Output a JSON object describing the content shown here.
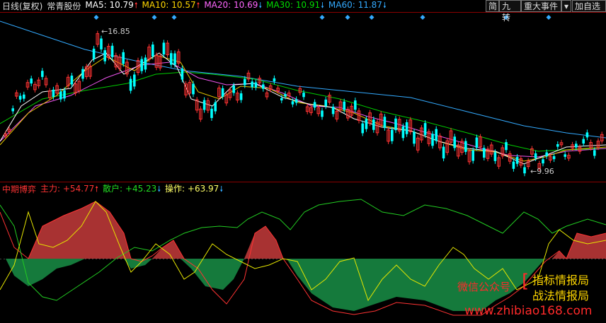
{
  "header": {
    "period": "日线(复权)",
    "stock": "常青股份",
    "ma": [
      {
        "label": "MA5: 10.79",
        "color": "#ffffff",
        "dir": "up"
      },
      {
        "label": "MA10: 10.57",
        "color": "#ffd700",
        "dir": "up"
      },
      {
        "label": "MA20: 10.69",
        "color": "#ff66ff",
        "dir": "down"
      },
      {
        "label": "MA30: 10.91",
        "color": "#00dd00",
        "dir": "down"
      },
      {
        "label": "MA60: 11.87",
        "color": "#33aaff",
        "dir": "down"
      }
    ]
  },
  "toolbar": {
    "simple": "简",
    "nine_turn": "九转",
    "major_event": "重大事件",
    "add_self": "加自选"
  },
  "chart": {
    "high_label": "16.85",
    "low_label": "9.96"
  },
  "indicator": {
    "title": "中期博弈",
    "main": "主力: +54.77",
    "retail": "散户: +45.23",
    "op": "操作: +63.97",
    "colors": {
      "up": "#ff3333",
      "down": "#33aaff",
      "main_fill": "#a83232",
      "retail_fill": "#157a3c"
    }
  },
  "watermark": {
    "wechat": "微信公众号",
    "l1": "指标情报局",
    "l2": "战法情报局",
    "url": "www.zhibiao168.com"
  }
}
